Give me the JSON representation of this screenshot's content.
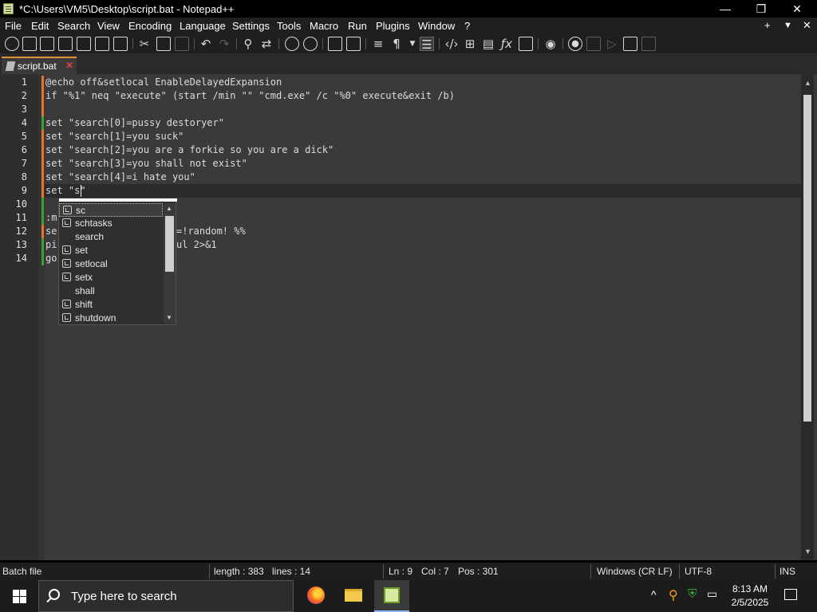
{
  "window": {
    "title": "*C:\\Users\\VM5\\Desktop\\script.bat - Notepad++",
    "minimize": "—",
    "maximize": "❐",
    "close": "✕"
  },
  "menu": {
    "items": [
      "File",
      "Edit",
      "Search",
      "View",
      "Encoding",
      "Language",
      "Settings",
      "Tools",
      "Macro",
      "Run",
      "Plugins",
      "Window",
      "?"
    ],
    "right_plus": "+",
    "right_down": "▼",
    "right_close": "✕"
  },
  "tab": {
    "label": "script.bat",
    "close": "✕"
  },
  "editor": {
    "line_numbers": [
      "1",
      "2",
      "3",
      "4",
      "5",
      "6",
      "7",
      "8",
      "9",
      "10",
      "11",
      "12",
      "13",
      "14"
    ],
    "lines": [
      "@echo off&setlocal EnableDelayedExpansion",
      "if \"%1\" neq \"execute\" (start /min \"\" \"cmd.exe\" /c \"%0\" execute&exit /b)",
      "",
      "set \"search[0]=pussy destoryer\"",
      "set \"search[1]=you suck\"",
      "set \"search[2]=you are a forkie so you are a dick\"",
      "set \"search[3]=you shall not exist\"",
      "set \"search[4]=i hate you\"",
      "set \"s\"",
      "",
      ":m",
      "se",
      "pi",
      "go"
    ],
    "partial_right": {
      "line12": "=!random! %%",
      "line13": "ul 2>&1"
    }
  },
  "autocomplete": {
    "items": [
      {
        "label": "sc",
        "icon": "cube-icon"
      },
      {
        "label": "schtasks",
        "icon": "cube-icon"
      },
      {
        "label": "search",
        "icon": ""
      },
      {
        "label": "set",
        "icon": "cube-icon"
      },
      {
        "label": "setlocal",
        "icon": "cube-icon"
      },
      {
        "label": "setx",
        "icon": "cube-icon"
      },
      {
        "label": "shall",
        "icon": ""
      },
      {
        "label": "shift",
        "icon": "cube-icon"
      },
      {
        "label": "shutdown",
        "icon": "cube-icon"
      }
    ],
    "up": "▲",
    "down": "▼"
  },
  "status": {
    "type": "Batch file",
    "length": "length : 383",
    "lines": "lines : 14",
    "ln": "Ln : 9",
    "col": "Col : 7",
    "pos": "Pos : 301",
    "eol": "Windows (CR LF)",
    "encoding": "UTF-8",
    "mode": "INS"
  },
  "taskbar": {
    "search_placeholder": "Type here to search",
    "time": "8:13 AM",
    "date": "2/5/2025",
    "tray_up": "^"
  },
  "colors": {
    "tab_accent": "#e69137",
    "change_orange": "#e5732b",
    "change_green": "#3aa335"
  }
}
